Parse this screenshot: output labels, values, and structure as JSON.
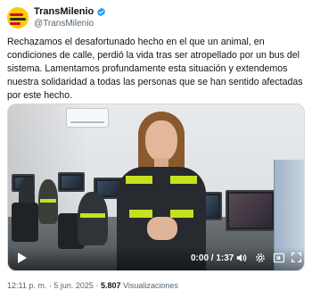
{
  "account": {
    "display_name": "TransMilenio",
    "handle": "@TransMilenio"
  },
  "tweet": {
    "text": "Rechazamos el desafortunado hecho en el que un animal, en condiciones de calle, perdió la vida tras ser atropellado por un bus del sistema. Lamentamos profundamente esta situación y extendemos nuestra solidaridad a todas las personas que se han sentido afectadas por este hecho."
  },
  "video": {
    "time_display": "0:00 / 1:37",
    "progress": 0
  },
  "meta": {
    "time": "12:11 p. m.",
    "separator": "·",
    "date": "5 jun. 2025",
    "views_count": "5.807",
    "views_label": "Visualizaciones"
  },
  "colors": {
    "verified_badge": "#1d9bf0",
    "text_primary": "#0f1419",
    "text_secondary": "#536471",
    "vest_stripe": "#c7e11e",
    "brand_yellow": "#ffcc00",
    "brand_red": "#c8102e"
  },
  "icons": [
    "verified-badge-icon",
    "play-icon",
    "volume-icon",
    "settings-icon",
    "picture-in-picture-icon",
    "fullscreen-icon"
  ]
}
